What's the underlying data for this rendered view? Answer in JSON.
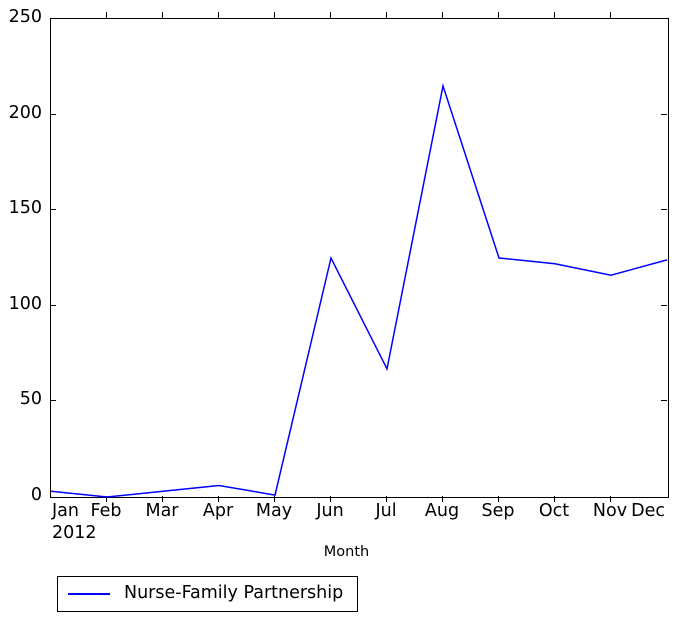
{
  "chart_data": {
    "type": "line",
    "title": "",
    "xlabel": "Month",
    "ylabel": "",
    "categories": [
      "Jan",
      "Feb",
      "Mar",
      "Apr",
      "May",
      "Jun",
      "Jul",
      "Aug",
      "Sep",
      "Oct",
      "Nov",
      "Dec"
    ],
    "x_sublabel": "2012",
    "series": [
      {
        "name": "Nurse-Family Partnership",
        "color": "#0000ff",
        "values": [
          3,
          0,
          3,
          6,
          1,
          125,
          67,
          215,
          125,
          122,
          116,
          124
        ]
      }
    ],
    "ylim": [
      0,
      250
    ],
    "yticks": [
      0,
      50,
      100,
      150,
      200,
      250
    ],
    "ytick_labels": [
      "0",
      "50",
      "100",
      "150",
      "200",
      "250"
    ],
    "grid": false,
    "legend": {
      "position": "below-axes-left",
      "entries": [
        {
          "label": "Nurse-Family Partnership",
          "color": "#0000ff"
        }
      ]
    },
    "axis": {
      "frame_color": "#000000",
      "background": "#ffffff"
    }
  }
}
